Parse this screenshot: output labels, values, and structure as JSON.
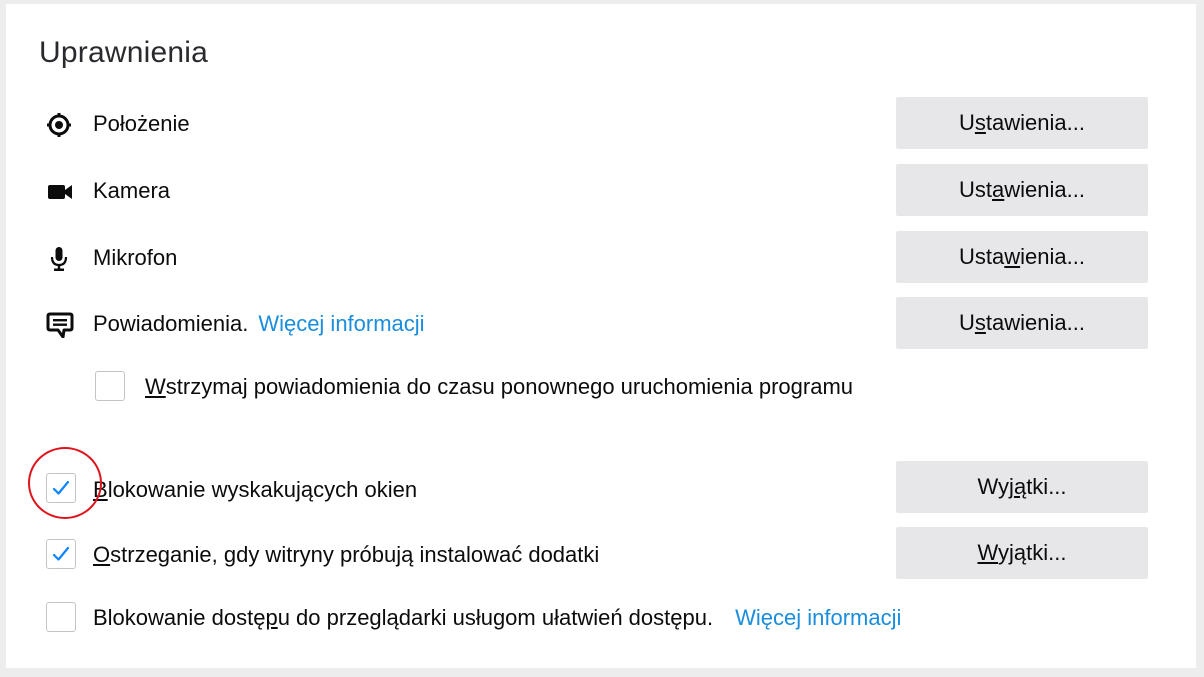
{
  "section": {
    "title": "Uprawnienia"
  },
  "permissions": [
    {
      "label": "Położenie",
      "icon": "location-icon",
      "button": {
        "pre": "U",
        "acc": "s",
        "post": "tawienia..."
      }
    },
    {
      "label": "Kamera",
      "icon": "camera-icon",
      "button": {
        "pre": "Ust",
        "acc": "a",
        "post": "wienia..."
      }
    },
    {
      "label": "Mikrofon",
      "icon": "microphone-icon",
      "button": {
        "pre": "Usta",
        "acc": "w",
        "post": "ienia..."
      }
    },
    {
      "label": "Powiadomienia.",
      "link": "Więcej informacji",
      "icon": "notification-icon",
      "button": {
        "pre": "U",
        "acc": "s",
        "post": "tawienia..."
      }
    }
  ],
  "pause_notifications": {
    "checked": false,
    "label_acc": "W",
    "label_rest": "strzymaj powiadomienia do czasu ponownego uruchomienia programu"
  },
  "block_popups": {
    "checked": true,
    "label_acc": "B",
    "label_rest": "lokowanie wyskakujących okien",
    "button": {
      "pre": "Wyj",
      "acc": "ą",
      "post": "tki..."
    }
  },
  "warn_addons": {
    "checked": true,
    "label_acc": "O",
    "label_rest": "strzeganie, gdy witryny próbują instalować dodatki",
    "button": {
      "pre": "",
      "acc": "W",
      "post": "yjątki..."
    }
  },
  "block_accessibility": {
    "checked": false,
    "label_pre": "Blokowanie dostę",
    "label_acc": "p",
    "label_post": "u do przeglądarki usługom ułatwień dostępu.",
    "link": "Więcej informacji"
  },
  "colors": {
    "link": "#1a8ddd",
    "checkmark": "#0a84ff",
    "button_bg": "#e7e7e9",
    "annotation_circle": "#e0141e"
  }
}
